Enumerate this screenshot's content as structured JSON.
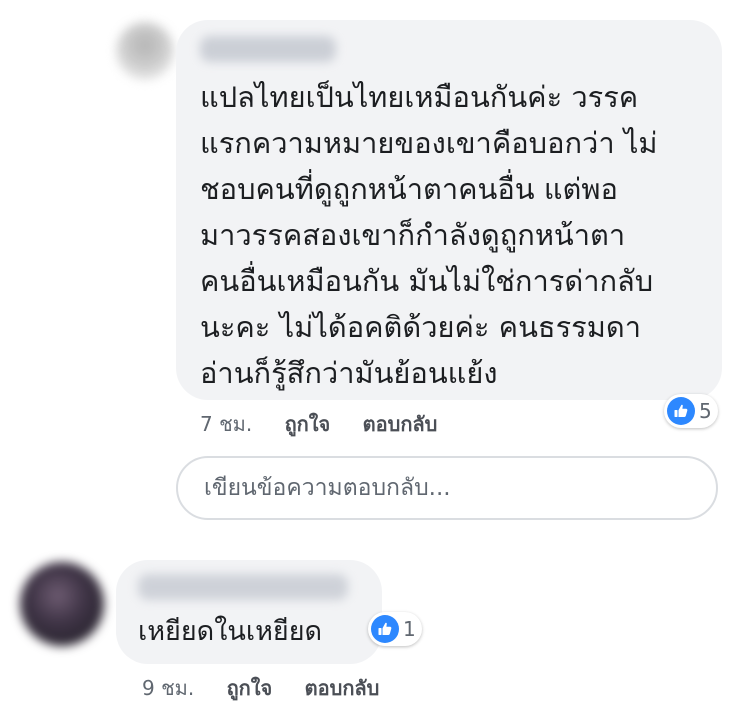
{
  "comment1": {
    "lines": [
      "แปลไทยเป็นไทยเหมือนกันค่ะ วรรค",
      "แรกความหมายของเขาคือบอกว่า ไม่",
      "ชอบคนที่ดูถูกหน้าตาคนอื่น แต่พอ",
      "มาวรรคสองเขาก็กำลังดูถูกหน้าตา",
      "คนอื่นเหมือนกัน มันไม่ใช่การด่ากลับ",
      "นะคะ ไม่ได้อคติด้วยค่ะ คนธรรมดา",
      "อ่านก็รู้สึกว่ามันย้อนแย้ง"
    ],
    "time": "7 ชม.",
    "like_label": "ถูกใจ",
    "reply_label": "ตอบกลับ",
    "reaction_count": "5"
  },
  "reply_box": {
    "placeholder": "เขียนข้อความตอบกลับ..."
  },
  "comment2": {
    "text": "เหยียดในเหยียด",
    "time": "9 ชม.",
    "like_label": "ถูกใจ",
    "reply_label": "ตอบกลับ",
    "reaction_count": "1"
  },
  "colors": {
    "bubble": "#f2f3f5",
    "like_blue": "#2d88ff",
    "meta_text": "#606770"
  }
}
